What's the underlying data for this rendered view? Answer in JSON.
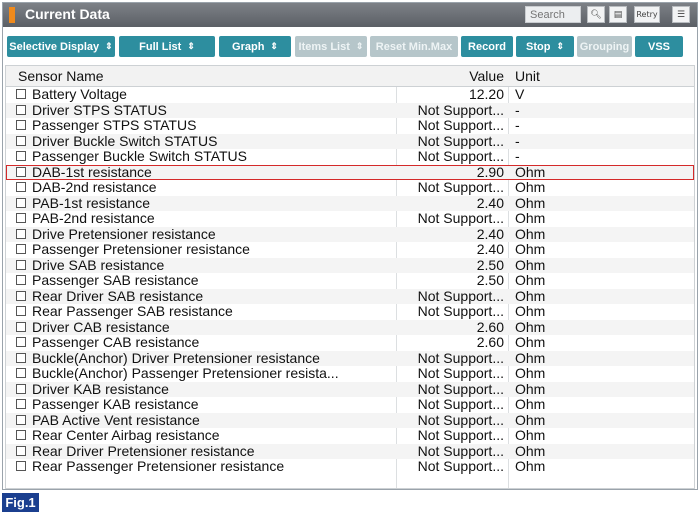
{
  "window": {
    "title": "Current Data"
  },
  "search": {
    "placeholder": "Search"
  },
  "toolbar_icons": [
    {
      "name": "search-zoom-icon",
      "glyph": "🔍︎"
    },
    {
      "name": "list-view-icon",
      "glyph": "▤"
    },
    {
      "name": "retry-icon",
      "glyph": "Retry"
    },
    {
      "name": "menu-icon",
      "glyph": "☰"
    }
  ],
  "toolbar": {
    "selective_display": "Selective Display",
    "full_list": "Full List",
    "graph": "Graph",
    "items_list": "Items List",
    "reset_min_max": "Reset Min.Max",
    "record": "Record",
    "stop": "Stop",
    "grouping": "Grouping",
    "vss": "VSS"
  },
  "columns": {
    "name": "Sensor Name",
    "value": "Value",
    "unit": "Unit"
  },
  "rows": [
    {
      "name": "Battery Voltage",
      "value": "12.20",
      "unit": "V"
    },
    {
      "name": "Driver STPS STATUS",
      "value": "Not Support...",
      "unit": "-"
    },
    {
      "name": "Passenger STPS STATUS",
      "value": "Not Support...",
      "unit": "-"
    },
    {
      "name": "Driver Buckle Switch STATUS",
      "value": "Not Support...",
      "unit": "-"
    },
    {
      "name": "Passenger Buckle Switch STATUS",
      "value": "Not Support...",
      "unit": "-"
    },
    {
      "name": "DAB-1st resistance",
      "value": "2.90",
      "unit": "Ohm"
    },
    {
      "name": "DAB-2nd resistance",
      "value": "Not Support...",
      "unit": "Ohm"
    },
    {
      "name": "PAB-1st resistance",
      "value": "2.40",
      "unit": "Ohm"
    },
    {
      "name": "PAB-2nd resistance",
      "value": "Not Support...",
      "unit": "Ohm"
    },
    {
      "name": "Drive Pretensioner resistance",
      "value": "2.40",
      "unit": "Ohm"
    },
    {
      "name": "Passenger Pretensioner resistance",
      "value": "2.40",
      "unit": "Ohm"
    },
    {
      "name": "Drive SAB resistance",
      "value": "2.50",
      "unit": "Ohm"
    },
    {
      "name": "Passenger SAB resistance",
      "value": "2.50",
      "unit": "Ohm"
    },
    {
      "name": "Rear Driver SAB resistance",
      "value": "Not Support...",
      "unit": "Ohm"
    },
    {
      "name": "Rear Passenger SAB resistance",
      "value": "Not Support...",
      "unit": "Ohm"
    },
    {
      "name": "Driver CAB resistance",
      "value": "2.60",
      "unit": "Ohm"
    },
    {
      "name": "Passenger CAB resistance",
      "value": "2.60",
      "unit": "Ohm"
    },
    {
      "name": "Buckle(Anchor) Driver Pretensioner resistance",
      "value": "Not Support...",
      "unit": "Ohm"
    },
    {
      "name": "Buckle(Anchor) Passenger Pretensioner resista...",
      "value": "Not Support...",
      "unit": "Ohm"
    },
    {
      "name": "Driver KAB resistance",
      "value": "Not Support...",
      "unit": "Ohm"
    },
    {
      "name": "Passenger KAB resistance",
      "value": "Not Support...",
      "unit": "Ohm"
    },
    {
      "name": "PAB Active Vent resistance",
      "value": "Not Support...",
      "unit": "Ohm"
    },
    {
      "name": "Rear Center Airbag resistance",
      "value": "Not Support...",
      "unit": "Ohm"
    },
    {
      "name": "Rear Driver Pretensioner resistance",
      "value": "Not Support...",
      "unit": "Ohm"
    },
    {
      "name": "Rear Passenger Pretensioner resistance",
      "value": "Not Support...",
      "unit": "Ohm"
    }
  ],
  "selected_row": 5,
  "figure_label": "Fig.1",
  "colors": {
    "button": "#2d8e9f",
    "button_disabled": "#b6c6ca",
    "highlight": "#d42a2a",
    "title_accent": "#f08a1c",
    "fig_label": "#1b3f8f"
  }
}
